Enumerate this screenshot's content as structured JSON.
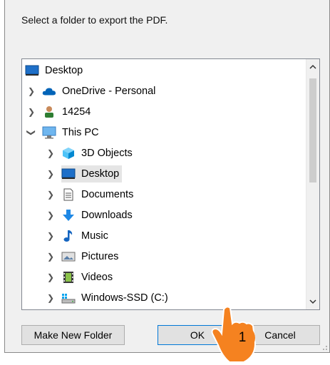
{
  "dialog": {
    "prompt": "Select a folder to export the PDF."
  },
  "tree": {
    "root": {
      "label": "Desktop",
      "icon": "desktop-icon"
    },
    "items": [
      {
        "label": "OneDrive - Personal",
        "icon": "onedrive-cloud-icon",
        "expander": "collapsed"
      },
      {
        "label": "14254",
        "icon": "user-icon",
        "expander": "collapsed"
      },
      {
        "label": "This PC",
        "icon": "this-pc-icon",
        "expander": "expanded"
      },
      {
        "label": "3D Objects",
        "icon": "3d-objects-icon",
        "expander": "collapsed"
      },
      {
        "label": "Desktop",
        "icon": "desktop-icon",
        "expander": "collapsed",
        "selected": true
      },
      {
        "label": "Documents",
        "icon": "documents-icon",
        "expander": "collapsed"
      },
      {
        "label": "Downloads",
        "icon": "downloads-icon",
        "expander": "collapsed"
      },
      {
        "label": "Music",
        "icon": "music-icon",
        "expander": "collapsed"
      },
      {
        "label": "Pictures",
        "icon": "pictures-icon",
        "expander": "collapsed"
      },
      {
        "label": "Videos",
        "icon": "videos-icon",
        "expander": "collapsed"
      },
      {
        "label": "Windows-SSD (C:)",
        "icon": "drive-icon",
        "expander": "collapsed"
      }
    ]
  },
  "buttons": {
    "make_new_folder": "Make New Folder",
    "ok": "OK",
    "cancel": "Cancel"
  },
  "annotation": {
    "step_number": "1",
    "color": "#f58220"
  }
}
